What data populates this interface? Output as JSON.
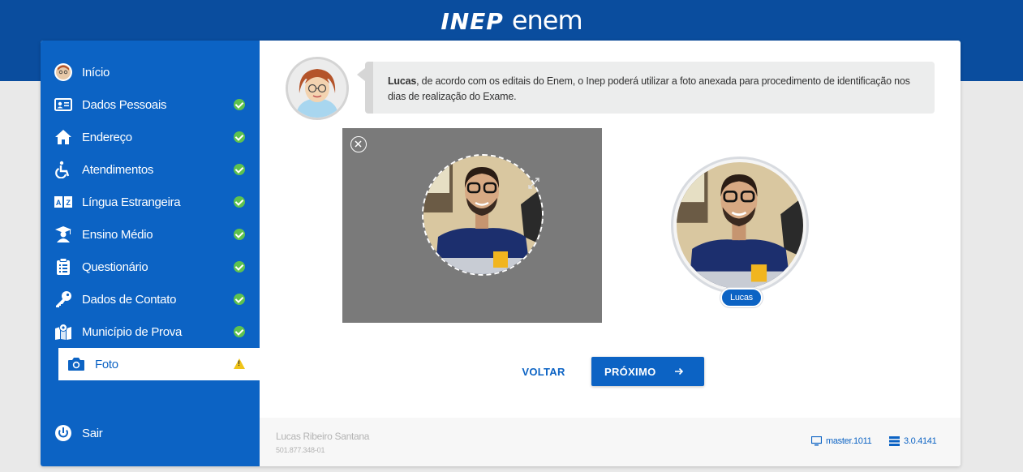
{
  "header": {
    "logo_inep": "INEP",
    "logo_enem": "enem"
  },
  "sidebar": {
    "items": [
      {
        "label": "Início",
        "icon": "avatar-icon",
        "status": ""
      },
      {
        "label": "Dados Pessoais",
        "icon": "id-card-icon",
        "status": "complete"
      },
      {
        "label": "Endereço",
        "icon": "home-icon",
        "status": "complete"
      },
      {
        "label": "Atendimentos",
        "icon": "wheelchair-icon",
        "status": "complete"
      },
      {
        "label": "Língua Estrangeira",
        "icon": "translate-icon",
        "status": "complete"
      },
      {
        "label": "Ensino Médio",
        "icon": "graduate-icon",
        "status": "complete"
      },
      {
        "label": "Questionário",
        "icon": "clipboard-icon",
        "status": "complete"
      },
      {
        "label": "Dados de Contato",
        "icon": "key-icon",
        "status": "complete"
      },
      {
        "label": "Município de Prova",
        "icon": "map-icon",
        "status": "complete"
      },
      {
        "label": "Foto",
        "icon": "camera-icon",
        "status": "warning",
        "active": true
      }
    ],
    "logout_label": "Sair"
  },
  "message": {
    "name": "Lucas",
    "text": ", de acordo com os editais do Enem, o Inep poderá utilizar a foto anexada para procedimento de identificação nos dias de realização do Exame."
  },
  "preview": {
    "name_tag": "Lucas"
  },
  "actions": {
    "back_label": "VOLTAR",
    "next_label": "PRÓXIMO"
  },
  "footer": {
    "user_name": "Lucas Ribeiro Santana",
    "cpf": "501.877.348-01",
    "branch": "master.1011",
    "version": "3.0.4141"
  },
  "colors": {
    "primary": "#0c63c4",
    "header": "#0a4d9e",
    "success": "#5ec24e",
    "warning": "#f0c419"
  }
}
